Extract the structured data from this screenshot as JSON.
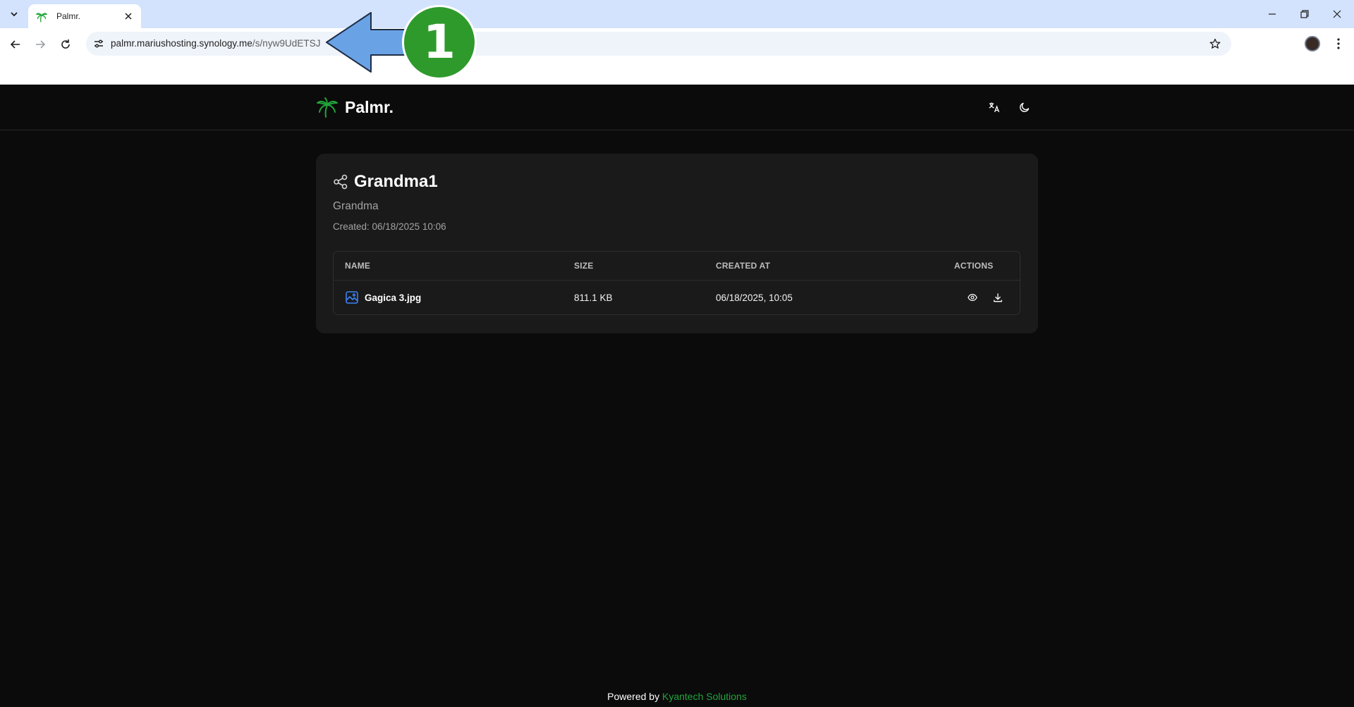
{
  "browser": {
    "tab": {
      "title": "Palmr."
    },
    "url": {
      "host": "palmr.mariushosting.synology.me",
      "path": "/s/nyw9UdETSJ"
    }
  },
  "annotation": {
    "step": "1",
    "arrow_color": "#6aa2e6",
    "badge_color": "#2e9a2c"
  },
  "app": {
    "brand": "Palmr.",
    "brand_color": "#22a53a"
  },
  "share": {
    "title": "Grandma1",
    "description": "Grandma",
    "created": "Created: 06/18/2025 10:06"
  },
  "table": {
    "headers": {
      "name": "NAME",
      "size": "SIZE",
      "created_at": "CREATED AT",
      "actions": "ACTIONS"
    },
    "rows": [
      {
        "name": "Gagica 3.jpg",
        "size": "811.1 KB",
        "created_at": "06/18/2025, 10:05"
      }
    ]
  },
  "footer": {
    "prefix": "Powered by",
    "company": "Kyantech Solutions"
  },
  "icons": [
    "chevron-down-icon",
    "palm-tree-icon",
    "close-icon",
    "minimize-icon",
    "restore-icon",
    "back-icon",
    "forward-icon",
    "reload-icon",
    "site-info-icon",
    "star-icon",
    "kebab-menu-icon",
    "translate-icon",
    "moon-icon",
    "share-icon",
    "image-file-icon",
    "eye-icon",
    "download-icon"
  ]
}
